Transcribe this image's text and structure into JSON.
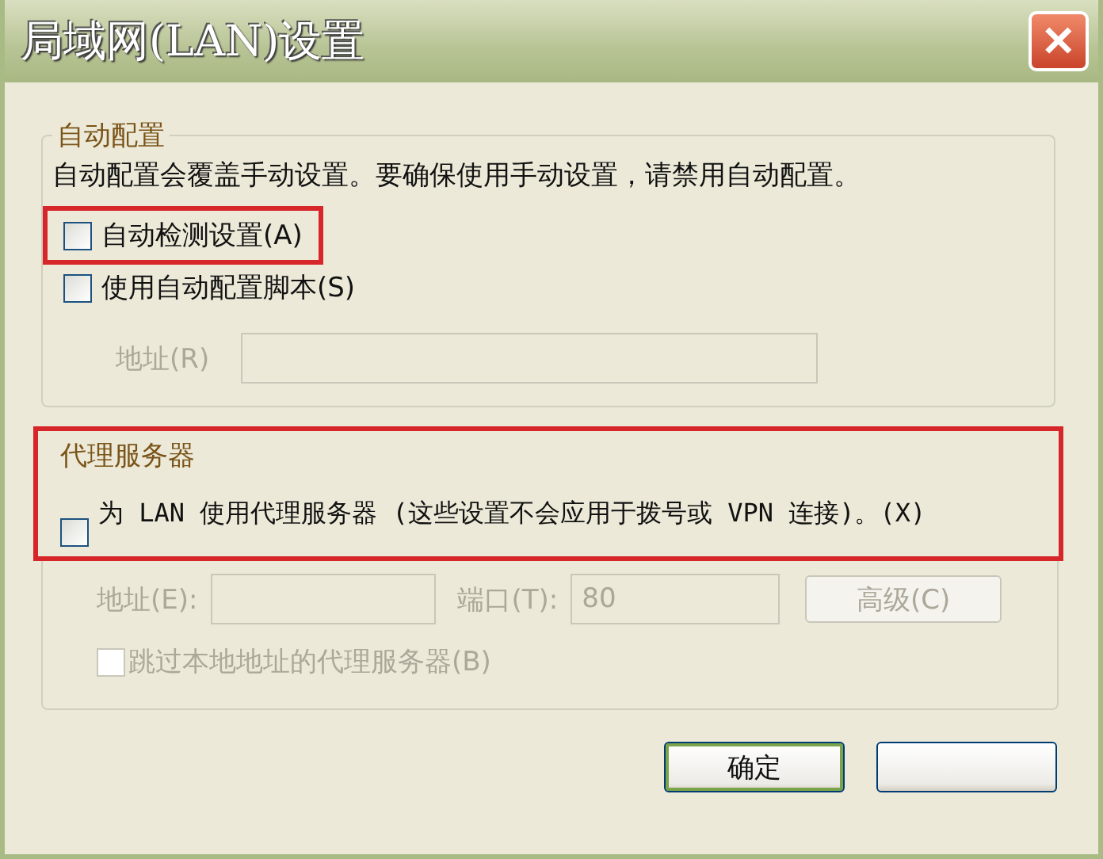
{
  "window": {
    "title": "局域网(LAN)设置",
    "close": "✕"
  },
  "auto_config": {
    "legend": "自动配置",
    "description": "自动配置会覆盖手动设置。要确保使用手动设置，请禁用自动配置。",
    "options": [
      {
        "label": "自动检测设置(A)",
        "checked": false,
        "highlighted": true
      },
      {
        "label": "使用自动配置脚本(S)",
        "checked": false,
        "highlighted": false
      }
    ],
    "address": {
      "label": "地址(R)",
      "disabled": true
    }
  },
  "proxy": {
    "legend": "代理服务器",
    "highlighted": true,
    "use_proxy": {
      "label": "为 LAN 使用代理服务器 (这些设置不会应用于拨号或 VPN 连接)。(X)",
      "checked": false
    },
    "address": {
      "label": "地址(E):",
      "disabled": true
    },
    "port": {
      "label": "端口(T):",
      "value": "80",
      "disabled": true
    },
    "advanced": {
      "label": "高级(C)",
      "disabled": true
    },
    "bypass": {
      "label": "跳过本地地址的代理服务器(B)",
      "checked": false,
      "disabled": true
    }
  },
  "buttons": [
    {
      "kind": "ok",
      "label": "确定",
      "default": true
    },
    {
      "kind": "cancel"
    }
  ]
}
